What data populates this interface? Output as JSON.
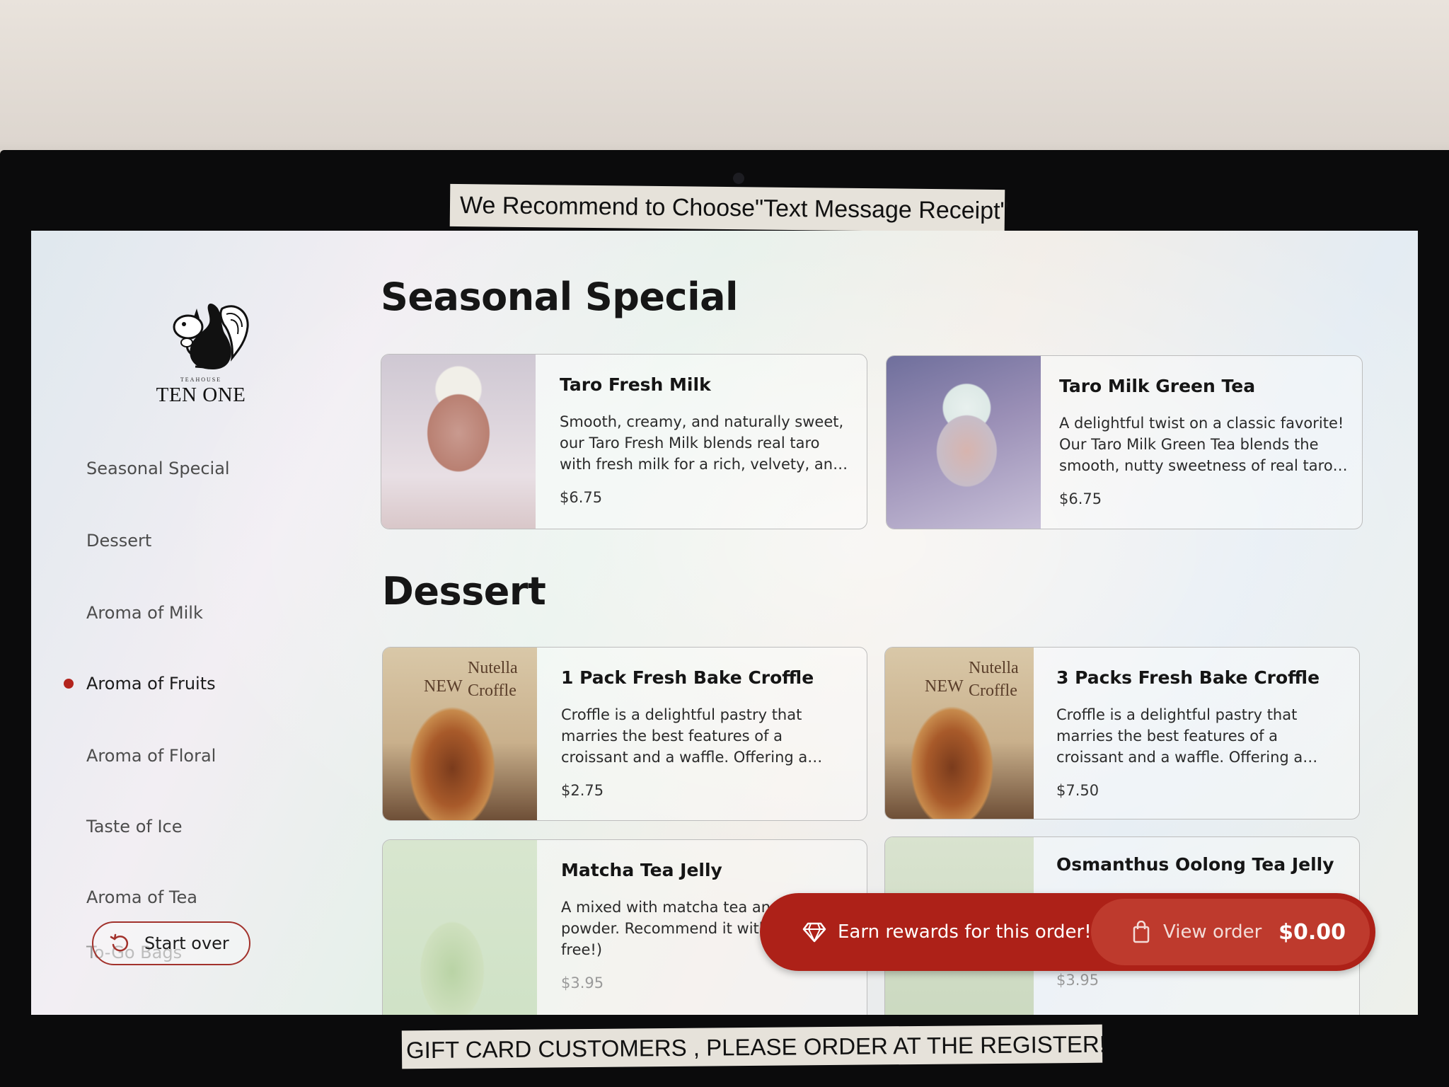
{
  "stickers": {
    "top": "We Recommend to Choose\"Text Message Receipt\"",
    "bottom": "GIFT CARD CUSTOMERS , PLEASE ORDER AT THE REGISTER!"
  },
  "brand": {
    "small": "TEAHOUSE",
    "name": "TEN ONE"
  },
  "sidebar": {
    "items": [
      {
        "label": "Seasonal Special"
      },
      {
        "label": "Dessert"
      },
      {
        "label": "Aroma of Milk"
      },
      {
        "label": "Aroma of Fruits",
        "active": true
      },
      {
        "label": "Aroma of Floral"
      },
      {
        "label": "Taste of Ice"
      },
      {
        "label": "Aroma of Tea"
      },
      {
        "label": "To-Go Bags"
      }
    ],
    "start_over": "Start over"
  },
  "sections": [
    {
      "title": "Seasonal Special",
      "items": [
        {
          "name": "Taro Fresh Milk",
          "description": "Smooth, creamy, and naturally sweet, our Taro Fresh Milk blends real taro with fresh milk for a rich, velvety, and indulgent tr…",
          "price": "$6.75"
        },
        {
          "name": "Taro Milk Green Tea",
          "description": "A delightful twist on a classic favorite! Our Taro Milk Green Tea blends the smooth, nutty sweetness of real taro with the fre…",
          "price": "$6.75"
        }
      ]
    },
    {
      "title": "Dessert",
      "items": [
        {
          "name": "1 Pack Fresh Bake Croffle",
          "description": "Croffle is a delightful pastry that marries the best features of a croissant and a waffle. Offering a crispy outside with a …",
          "price": "$2.75",
          "image_text": [
            "NEW",
            "Nutella",
            "Croffle"
          ]
        },
        {
          "name": "3 Packs Fresh Bake Croffle",
          "description": "Croffle is a delightful pastry that marries the best features of a croissant and a waffle. Offering a crispy outside with a …",
          "price": "$7.50",
          "image_text": [
            "NEW",
            "Nutella",
            "Croffle"
          ]
        },
        {
          "name": "Matcha Tea Jelly",
          "description": "A mixed with matcha tea and a powder. Recommend it with boba (it's free!)",
          "price": "$3.95"
        },
        {
          "name": "Osmanthus Oolong Tea Jelly",
          "description": "",
          "price": "$3.95"
        }
      ]
    }
  ],
  "order_bar": {
    "rewards": "Earn rewards for this order!",
    "view_order": "View order",
    "total": "$0.00"
  },
  "colors": {
    "accent": "#ad2118",
    "accent_light": "#be3a2d",
    "active_dot": "#b3241d"
  }
}
